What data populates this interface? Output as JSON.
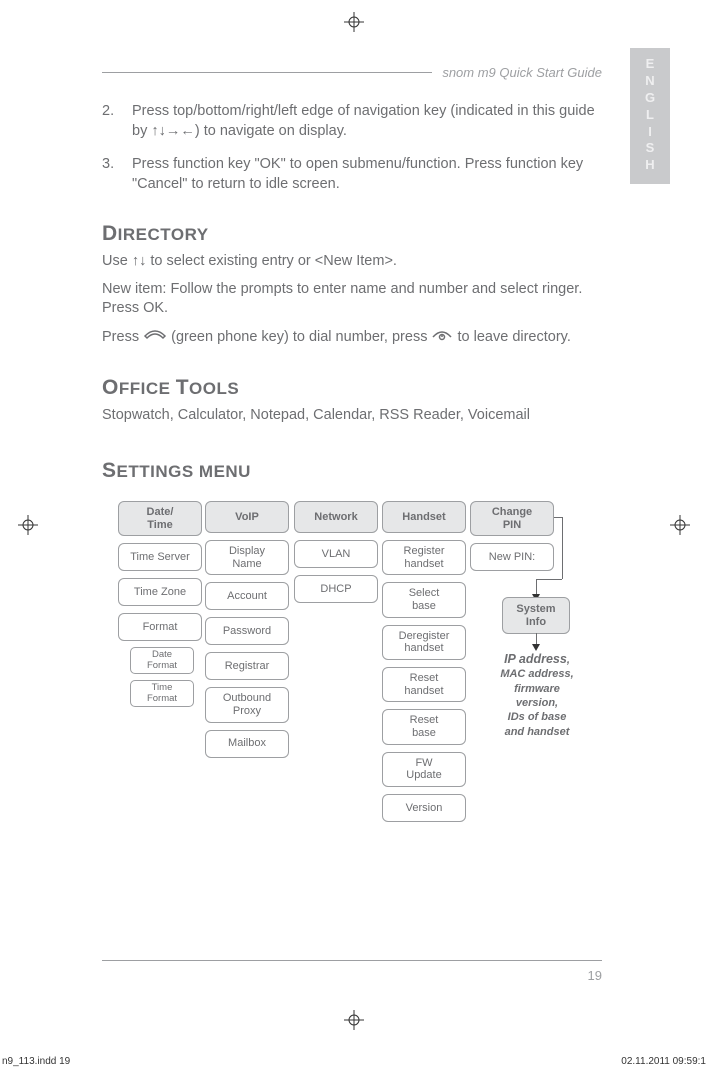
{
  "header": "snom m9 Quick Start Guide",
  "lang_tab": [
    "E",
    "N",
    "G",
    "L",
    "I",
    "S",
    "H"
  ],
  "steps": {
    "n2": "2.",
    "t2": "Press top/bottom/right/left edge of navigation key (indicated in this guide by ↑↓→←) to navigate on display.",
    "n3": "3.",
    "t3": "Press function key \"OK\" to open submenu/function. Press function key \"Cancel\" to return to idle screen."
  },
  "directory": {
    "head_first": "D",
    "head_rest": "IRECTORY",
    "p1": "Use ↑↓ to select existing entry or <New Item>.",
    "p2": "New item:  Follow the prompts to enter name and number and select ringer.  Press OK.",
    "p3a": "Press ",
    "p3b": " (green phone key) to dial number, press ",
    "p3c": " to leave directory."
  },
  "office": {
    "head_first": "O",
    "head_rest": "FFICE ",
    "head_first2": "T",
    "head_rest2": "OOLS",
    "p": "Stopwatch, Calculator, Notepad, Calendar, RSS Reader, Voicemail"
  },
  "settings": {
    "head_first": "S",
    "head_rest": "ETTINGS MENU"
  },
  "diagram": {
    "col1": {
      "head": "Date/\nTime",
      "items": [
        "Time Server",
        "Time Zone",
        "Format"
      ],
      "sub": [
        "Date\nFormat",
        "Time\nFormat"
      ]
    },
    "col2": {
      "head": "VoIP",
      "items": [
        "Display\nName",
        "Account",
        "Password",
        "Registrar",
        "Outbound\nProxy",
        "Mailbox"
      ]
    },
    "col3": {
      "head": "Network",
      "items": [
        "VLAN",
        "DHCP"
      ]
    },
    "col4": {
      "head": "Handset",
      "items": [
        "Register\nhandset",
        "Select\nbase",
        "Deregister\nhandset",
        "Reset\nhandset",
        "Reset\nbase",
        "FW\nUpdate",
        "Version"
      ]
    },
    "col5": {
      "head": "Change\nPIN",
      "items": [
        "New PIN:"
      ]
    },
    "sysinfo": "System\nInfo",
    "info": {
      "primary": "IP address",
      "rest": ",\nMAC address,\nfirmware\nversion,\nIDs of base\nand handset"
    }
  },
  "page_no": "19",
  "print_left": "n9_113.indd   19",
  "print_right": "02.11.2011   09:59:1"
}
